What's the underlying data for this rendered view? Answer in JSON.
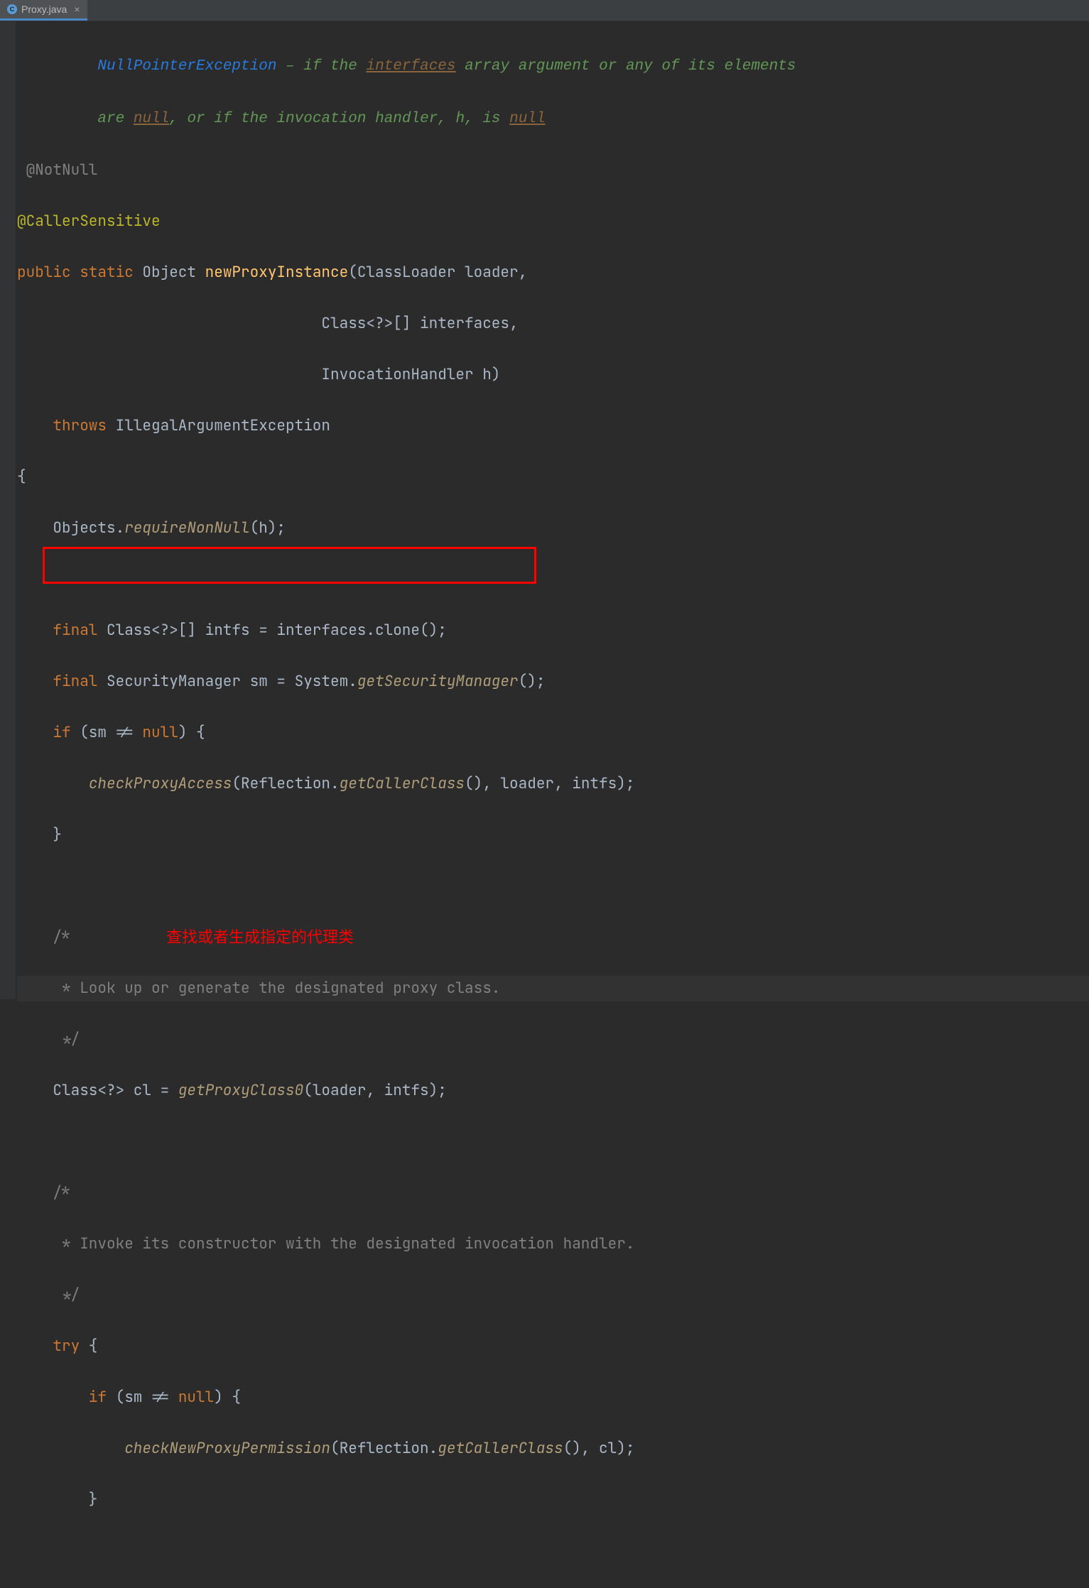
{
  "tab": {
    "filename": "Proxy.java",
    "icon_letter": "C",
    "close_glyph": "×"
  },
  "annotation_red": "查找或者生成指定的代理类",
  "code": {
    "jd1_a": "NullPointerException",
    "jd1_b": " – if the ",
    "jd1_c": "interfaces",
    "jd1_d": " array argument or any of its elements",
    "jd2_a": "are ",
    "jd2_b": "null",
    "jd2_c": ", or if the invocation handler, h, is ",
    "jd2_d": "null",
    "l3": " @NotNull",
    "l4": "@CallerSensitive",
    "l5_a": "public",
    "l5_b": " static",
    "l5_c": " Object ",
    "l5_d": "newProxyInstance",
    "l5_e": "(ClassLoader loader,",
    "l6": "                                  Class<?>[] interfaces,",
    "l7": "                                  InvocationHandler h)",
    "l8_a": "    throws",
    "l8_b": " IllegalArgumentException",
    "l9": "{",
    "l10_a": "    Objects.",
    "l10_b": "requireNonNull",
    "l10_c": "(h);",
    "l12_a": "    final",
    "l12_b": " Class<?>[] intfs = interfaces.clone();",
    "l13_a": "    final",
    "l13_b": " SecurityManager sm = System.",
    "l13_c": "getSecurityManager",
    "l13_d": "();",
    "l14_a": "    if",
    "l14_b": " (sm != ",
    "l14_c": "null",
    "l14_d": ") {",
    "l15_a": "        ",
    "l15_b": "checkProxyAccess",
    "l15_c": "(Reflection.",
    "l15_d": "getCallerClass",
    "l15_e": "(), loader, intfs);",
    "l16": "    }",
    "l18": "    /*",
    "l19": "     * Look up or generate the designated proxy class.",
    "l20": "     */",
    "l21_a": "    Class<?> cl = ",
    "l21_b": "getProxyClass0",
    "l21_c": "(loader, intfs);",
    "l23": "    /*",
    "l24": "     * Invoke its constructor with the designated invocation handler.",
    "l25": "     */",
    "l26_a": "    try",
    "l26_b": " {",
    "l27_a": "        if",
    "l27_b": " (sm != ",
    "l27_c": "null",
    "l27_d": ") {",
    "l28_a": "            ",
    "l28_b": "checkNewProxyPermission",
    "l28_c": "(Reflection.",
    "l28_d": "getCallerClass",
    "l28_e": "(), cl);",
    "l29": "        }"
  }
}
